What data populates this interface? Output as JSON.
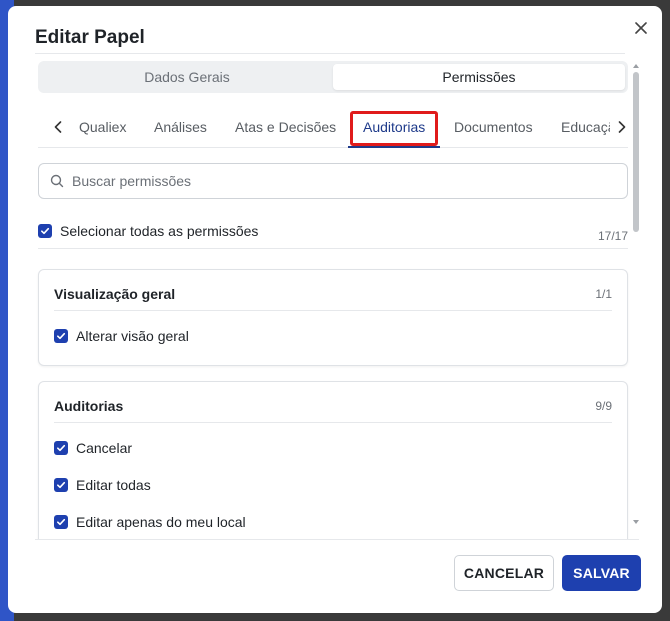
{
  "dialog": {
    "title": "Editar Papel"
  },
  "segments": [
    "Dados Gerais",
    "Permissões"
  ],
  "active_segment": "Permissões",
  "tabs": [
    "Qualiex",
    "Análises",
    "Atas e Decisões",
    "Auditorias",
    "Documentos",
    "Educação"
  ],
  "active_tab": "Auditorias",
  "search": {
    "placeholder": "Buscar permissões",
    "value": ""
  },
  "select_all": {
    "label": "Selecionar todas as permissões",
    "count": "17/17",
    "checked": true
  },
  "groups": [
    {
      "title": "Visualização geral",
      "count": "1/1",
      "items": [
        {
          "label": "Alterar visão geral",
          "checked": true
        }
      ]
    },
    {
      "title": "Auditorias",
      "count": "9/9",
      "items": [
        {
          "label": "Cancelar",
          "checked": true
        },
        {
          "label": "Editar todas",
          "checked": true
        },
        {
          "label": "Editar apenas do meu local",
          "checked": true
        }
      ]
    }
  ],
  "footer": {
    "cancel_label": "CANCELAR",
    "save_label": "SALVAR"
  },
  "colors": {
    "primary": "#1e40af",
    "highlight": "#e01b1b",
    "active_tab": "#1e3a8a"
  }
}
